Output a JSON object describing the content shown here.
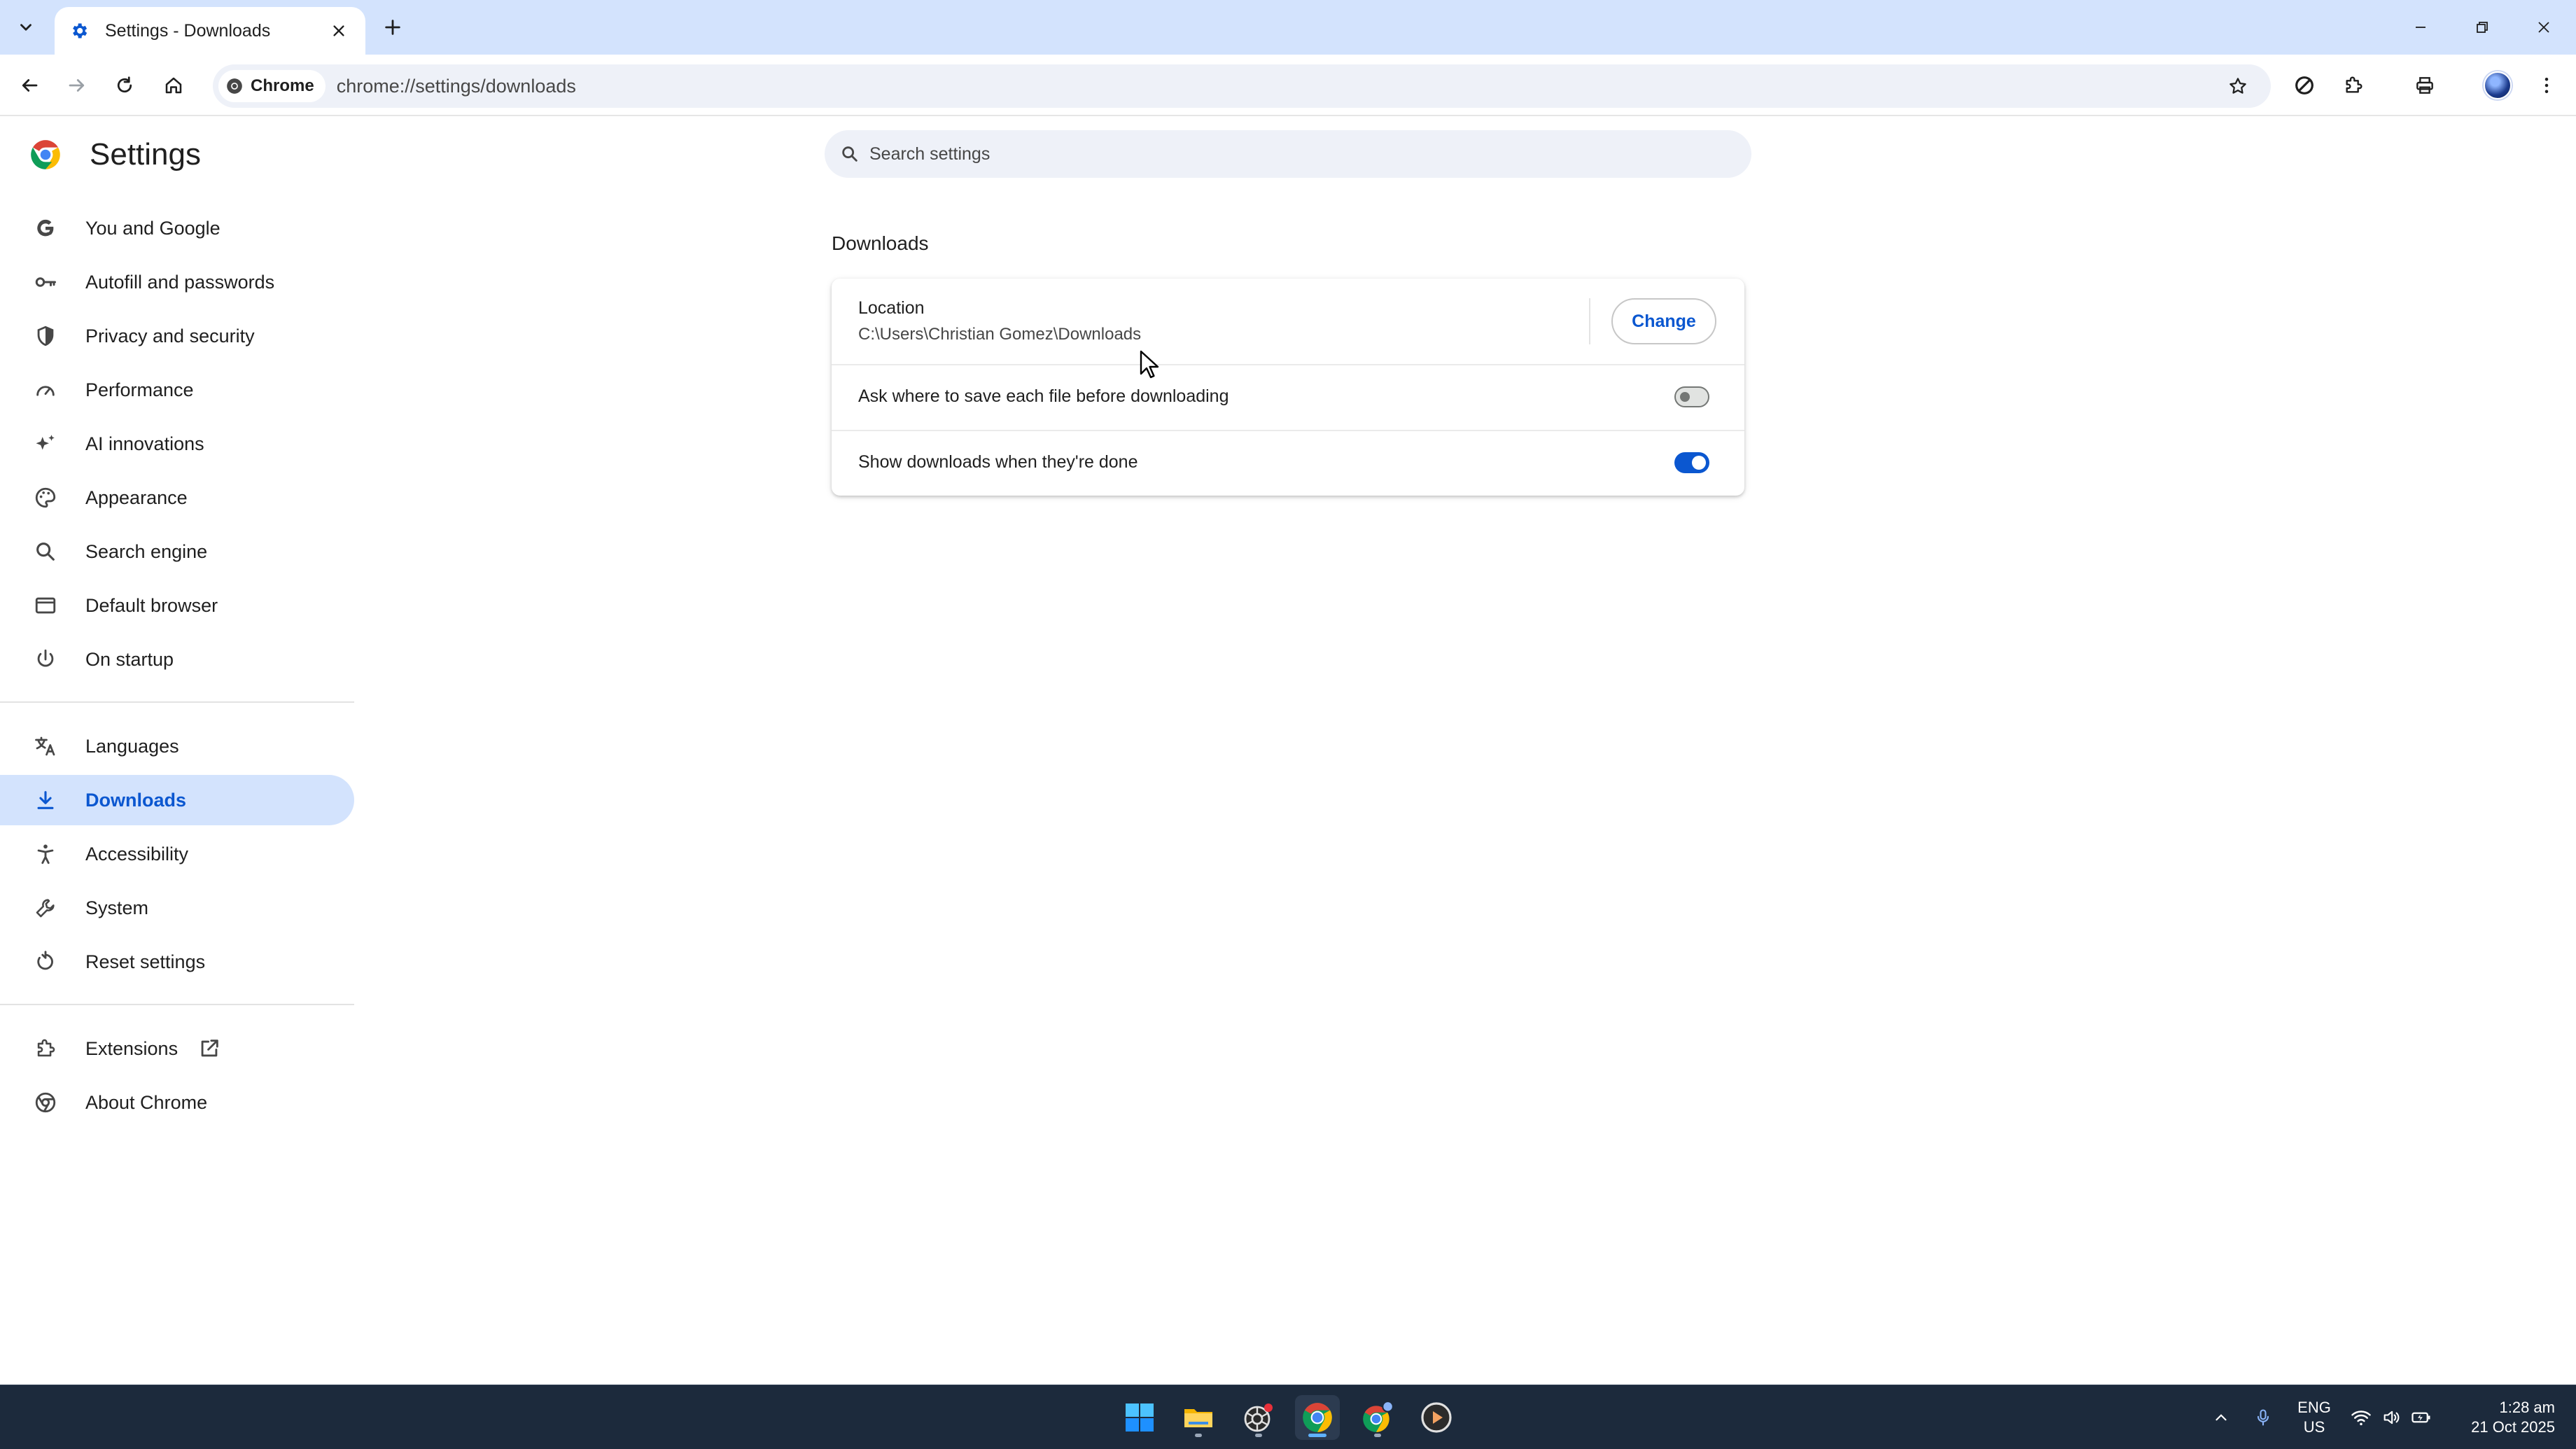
{
  "browser": {
    "tab_title": "Settings - Downloads",
    "url": "chrome://settings/downloads",
    "site_chip_label": "Chrome"
  },
  "settings": {
    "page_title": "Settings",
    "search_placeholder": "Search settings"
  },
  "sidebar": {
    "items": [
      {
        "label": "You and Google",
        "icon": "google-g-icon"
      },
      {
        "label": "Autofill and passwords",
        "icon": "key-icon"
      },
      {
        "label": "Privacy and security",
        "icon": "shield-icon"
      },
      {
        "label": "Performance",
        "icon": "speedometer-icon"
      },
      {
        "label": "AI innovations",
        "icon": "sparkle-icon"
      },
      {
        "label": "Appearance",
        "icon": "palette-icon"
      },
      {
        "label": "Search engine",
        "icon": "search-icon"
      },
      {
        "label": "Default browser",
        "icon": "browser-window-icon"
      },
      {
        "label": "On startup",
        "icon": "power-icon"
      },
      {
        "label": "Languages",
        "icon": "translate-icon"
      },
      {
        "label": "Downloads",
        "icon": "download-icon",
        "active": true
      },
      {
        "label": "Accessibility",
        "icon": "accessibility-icon"
      },
      {
        "label": "System",
        "icon": "wrench-icon"
      },
      {
        "label": "Reset settings",
        "icon": "reset-icon"
      },
      {
        "label": "Extensions",
        "icon": "puzzle-icon"
      },
      {
        "label": "About Chrome",
        "icon": "chrome-icon"
      }
    ]
  },
  "downloads": {
    "section_title": "Downloads",
    "location_label": "Location",
    "location_value": "C:\\Users\\Christian Gomez\\Downloads",
    "change_button": "Change",
    "ask_where_label": "Ask where to save each file before downloading",
    "ask_where_enabled": false,
    "show_when_done_label": "Show downloads when they're done",
    "show_when_done_enabled": true
  },
  "taskbar": {
    "lang_line1": "ENG",
    "lang_line2": "US",
    "time": "1:28 am",
    "date": "21 Oct 2025"
  },
  "colors": {
    "accent": "#0b57d0",
    "active_nav_bg": "#d3e3fd",
    "tabstrip_bg": "#d3e3fd",
    "taskbar_bg": "#1c2a3c"
  }
}
